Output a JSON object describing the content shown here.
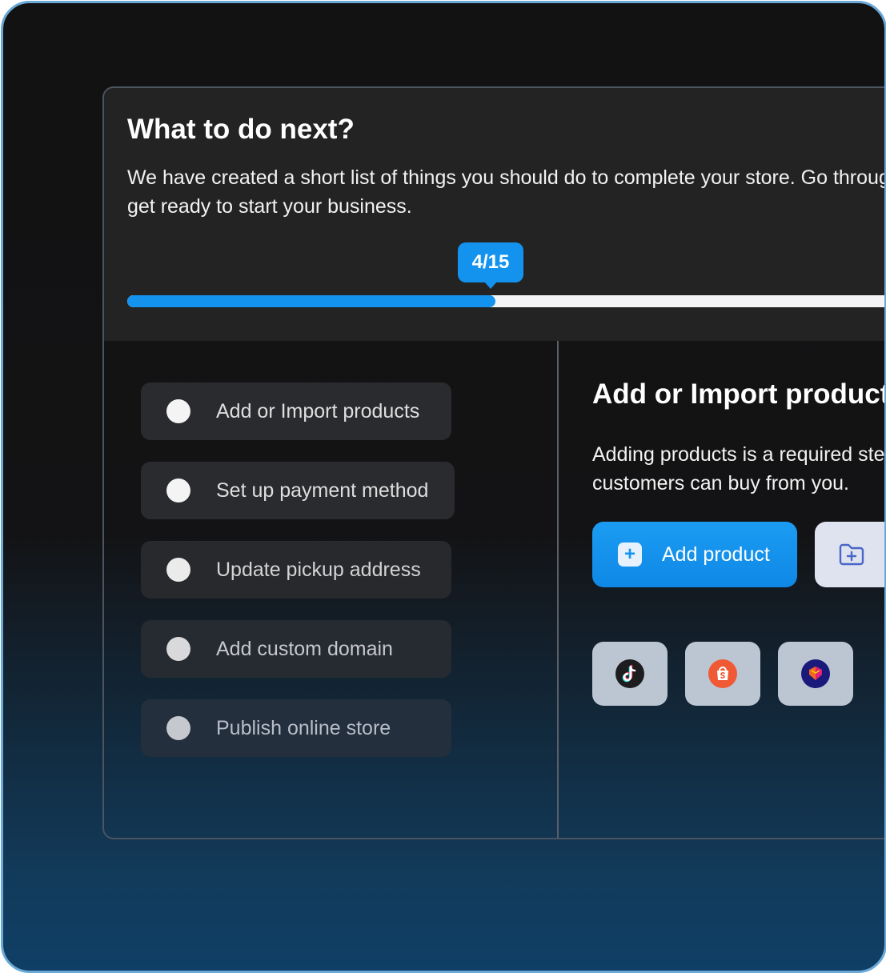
{
  "onboarding": {
    "title": "What to do next?",
    "description": "We have created a short list of things you should do to complete your store. Go through them and get ready to start your business.",
    "progress": {
      "label": "4/15",
      "completed": 4,
      "total": 15,
      "fraction": 0.27
    },
    "steps": [
      {
        "label": "Add or Import products"
      },
      {
        "label": "Set up payment method"
      },
      {
        "label": "Update pickup address"
      },
      {
        "label": "Add custom domain"
      },
      {
        "label": "Publish online store"
      }
    ]
  },
  "detail": {
    "title": "Add or Import products",
    "description": "Adding products is a required step so that your customers can buy from you.",
    "add_button": "Add product",
    "icons": {
      "plus": "plus-icon",
      "import": "folder-plus-icon",
      "tiktok": "tiktok-icon",
      "shopee": "shopee-icon",
      "lazada": "lazada-icon"
    }
  },
  "colors": {
    "accent": "#1493ee",
    "card": "#232324",
    "step": "#2a2b2e"
  }
}
